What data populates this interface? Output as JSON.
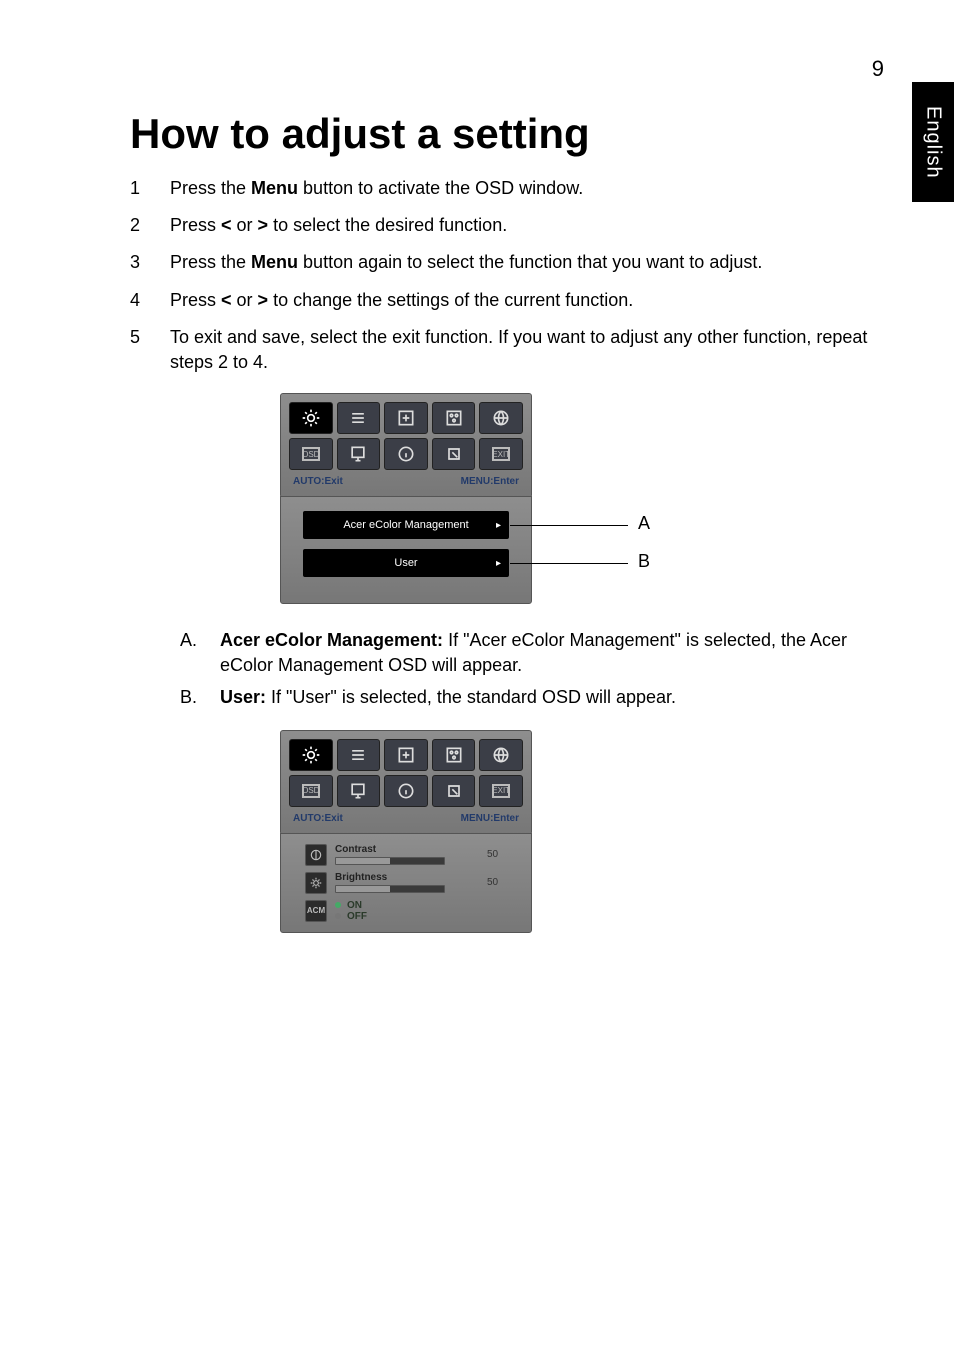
{
  "page_number": "9",
  "side_tab": "English",
  "heading": "How to adjust a setting",
  "steps": [
    {
      "num": "1",
      "pre": "Press the ",
      "bold": "Menu",
      "post": " button to activate the OSD window."
    },
    {
      "num": "2",
      "pre": "Press ",
      "bold": "<",
      "mid": " or ",
      "bold2": ">",
      "post": " to select the desired function."
    },
    {
      "num": "3",
      "pre": "Press the ",
      "bold": "Menu",
      "post": " button again to select the function that you want to adjust."
    },
    {
      "num": "4",
      "pre": "Press ",
      "bold": "<",
      "mid": " or ",
      "bold2": ">",
      "post": " to change the settings of the current function."
    },
    {
      "num": "5",
      "pre": "",
      "bold": "",
      "post": "To exit and save, select the exit function. If you want to adjust any other function, repeat steps 2 to 4."
    }
  ],
  "osd1": {
    "tabs_row1": [
      "brightness-icon",
      "list-icon",
      "position-icon",
      "color-icon",
      "globe-icon"
    ],
    "tabs_row2": [
      "osd-label",
      "lang-icon",
      "info-icon",
      "reset-icon",
      "exit-label"
    ],
    "osd_text": "OSD",
    "exit_text": "EXIT",
    "footer_left": "AUTO:Exit",
    "footer_right": "MENU:Enter",
    "menu_item_a": "Acer eColor Management",
    "menu_item_b": "User",
    "callout_a": "A",
    "callout_b": "B"
  },
  "sublist": [
    {
      "let": "A.",
      "bold": "Acer eColor Management:",
      "text": " If \"Acer eColor Management\" is selected, the Acer eColor Management OSD will appear."
    },
    {
      "let": "B.",
      "bold": "User:",
      "text": " If \"User\" is selected, the standard OSD will appear."
    }
  ],
  "osd2": {
    "contrast_label": "Contrast",
    "contrast_value": "50",
    "brightness_label": "Brightness",
    "brightness_value": "50",
    "acm_label": "ACM",
    "acm_on": "ON",
    "acm_off": "OFF"
  }
}
